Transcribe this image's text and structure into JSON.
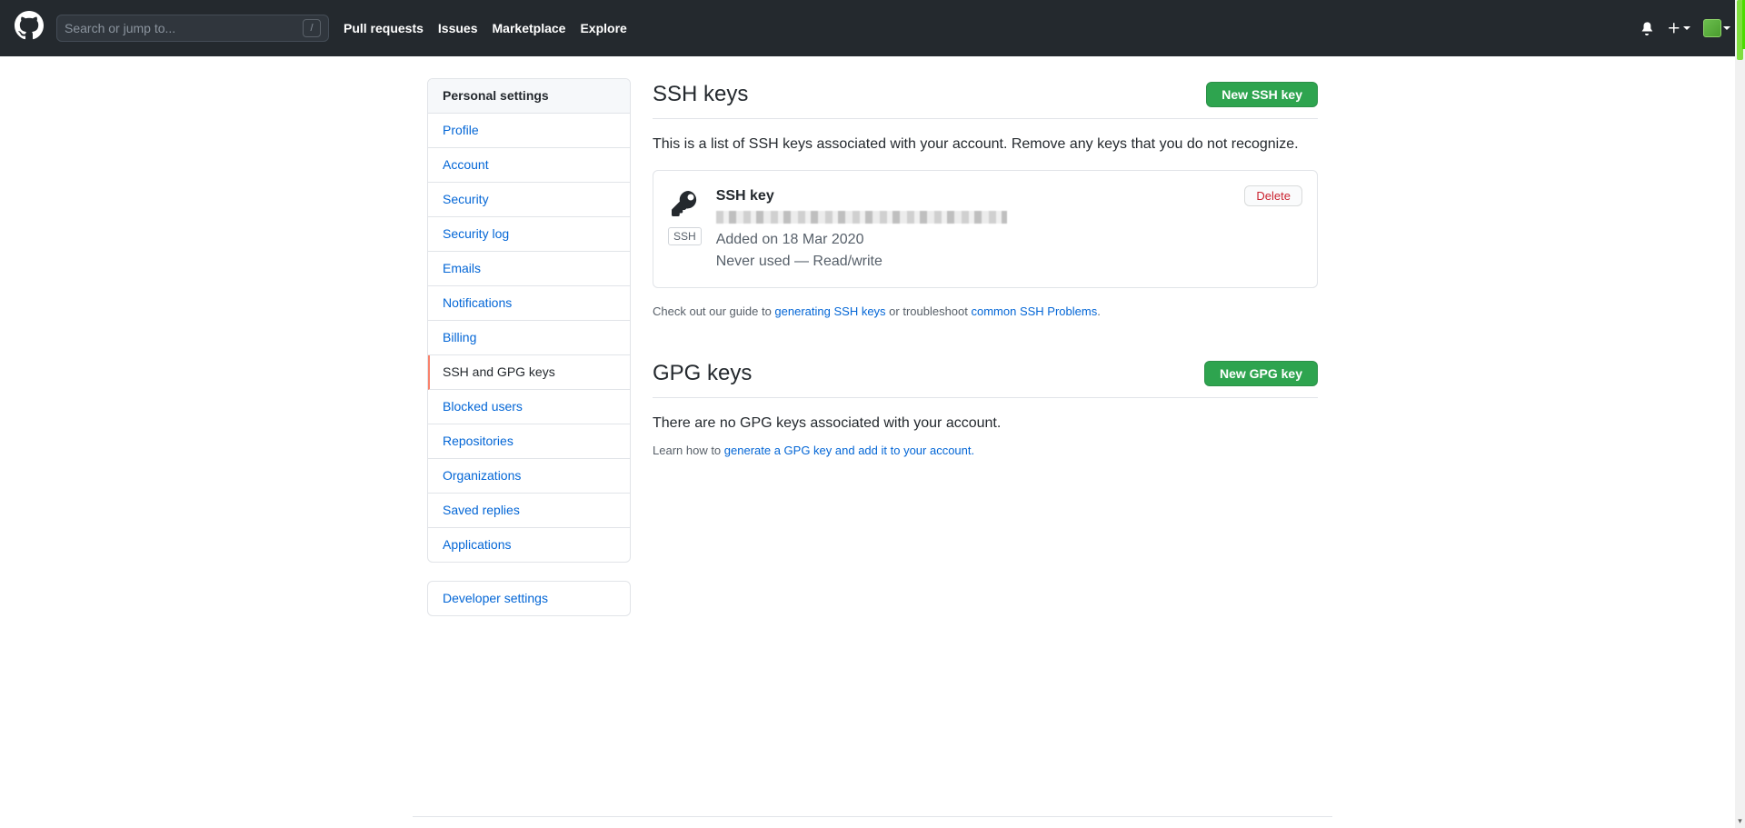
{
  "header": {
    "search_placeholder": "Search or jump to...",
    "kbd_hint": "/",
    "nav": {
      "pull_requests": "Pull requests",
      "issues": "Issues",
      "marketplace": "Marketplace",
      "explore": "Explore"
    }
  },
  "sidebar": {
    "heading": "Personal settings",
    "items": [
      {
        "label": "Profile"
      },
      {
        "label": "Account"
      },
      {
        "label": "Security"
      },
      {
        "label": "Security log"
      },
      {
        "label": "Emails"
      },
      {
        "label": "Notifications"
      },
      {
        "label": "Billing"
      },
      {
        "label": "SSH and GPG keys"
      },
      {
        "label": "Blocked users"
      },
      {
        "label": "Repositories"
      },
      {
        "label": "Organizations"
      },
      {
        "label": "Saved replies"
      },
      {
        "label": "Applications"
      }
    ],
    "developer_settings": "Developer settings"
  },
  "ssh": {
    "title": "SSH keys",
    "new_btn": "New SSH key",
    "desc": "This is a list of SSH keys associated with your account. Remove any keys that you do not recognize.",
    "key": {
      "title": "SSH key",
      "badge": "SSH",
      "added": "Added on 18 Mar 2020",
      "usage": "Never used — Read/write",
      "delete": "Delete"
    },
    "help_prefix": "Check out our guide to ",
    "help_link1": "generating SSH keys",
    "help_mid": " or troubleshoot ",
    "help_link2": "common SSH Problems",
    "help_suffix": "."
  },
  "gpg": {
    "title": "GPG keys",
    "new_btn": "New GPG key",
    "desc": "There are no GPG keys associated with your account.",
    "help_prefix": "Learn how to ",
    "help_link": "generate a GPG key and add it to your account."
  }
}
